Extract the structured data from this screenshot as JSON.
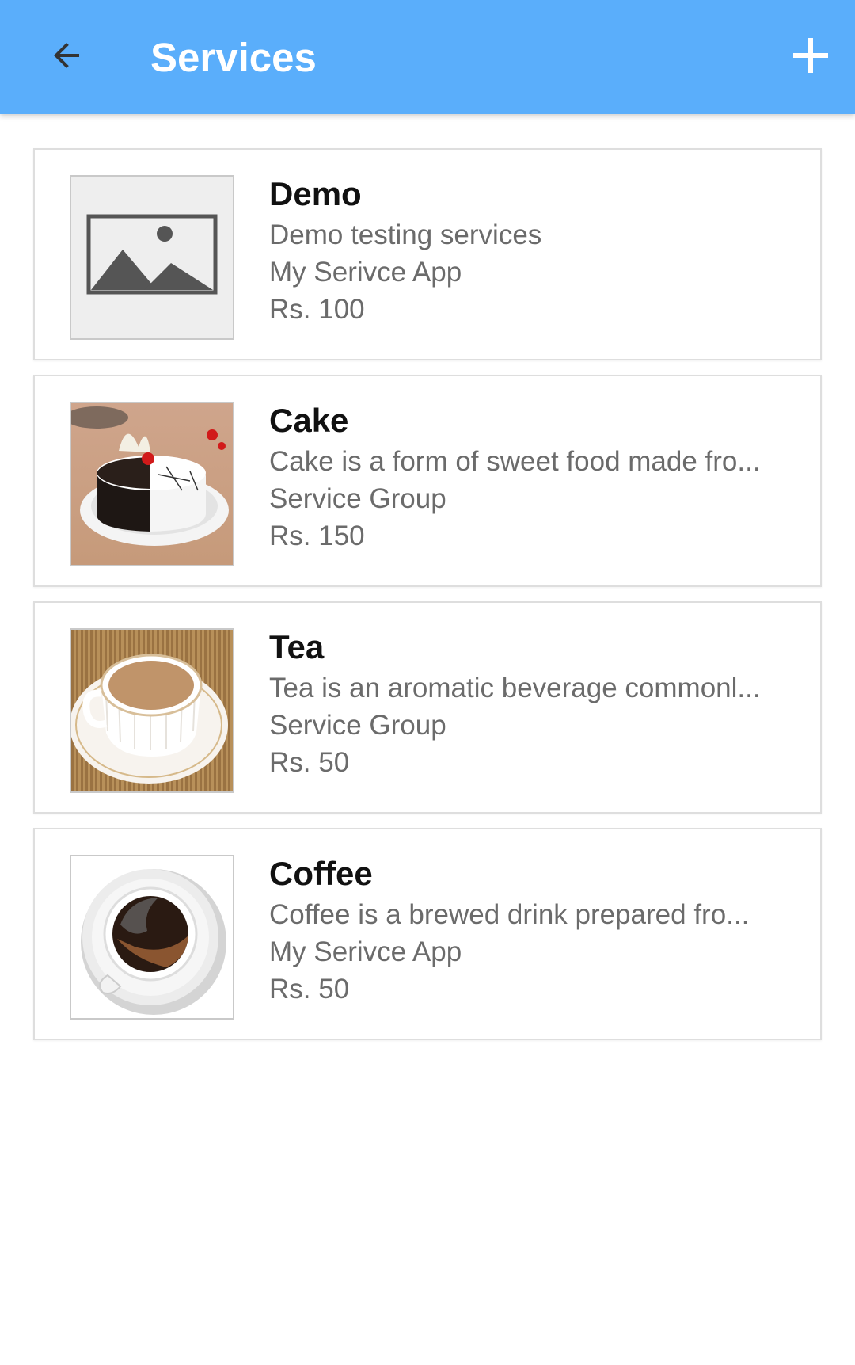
{
  "header": {
    "title": "Services",
    "back_icon": "arrow-left-icon",
    "add_icon": "plus-icon",
    "background_color": "#5aaefb"
  },
  "services": [
    {
      "name": "Demo",
      "description": "Demo testing services",
      "group": "My Serivce App",
      "price": "Rs. 100",
      "image": "placeholder-image-icon"
    },
    {
      "name": "Cake",
      "description": "Cake is a form of sweet food made fro...",
      "group": "Service Group",
      "price": "Rs. 150",
      "image": "cake-photo"
    },
    {
      "name": "Tea",
      "description": "Tea is an aromatic beverage commonl...",
      "group": "Service Group",
      "price": "Rs. 50",
      "image": "tea-cup-photo"
    },
    {
      "name": "Coffee",
      "description": "Coffee is a brewed drink prepared fro...",
      "group": "My Serivce App",
      "price": "Rs. 50",
      "image": "coffee-cup-photo"
    }
  ]
}
